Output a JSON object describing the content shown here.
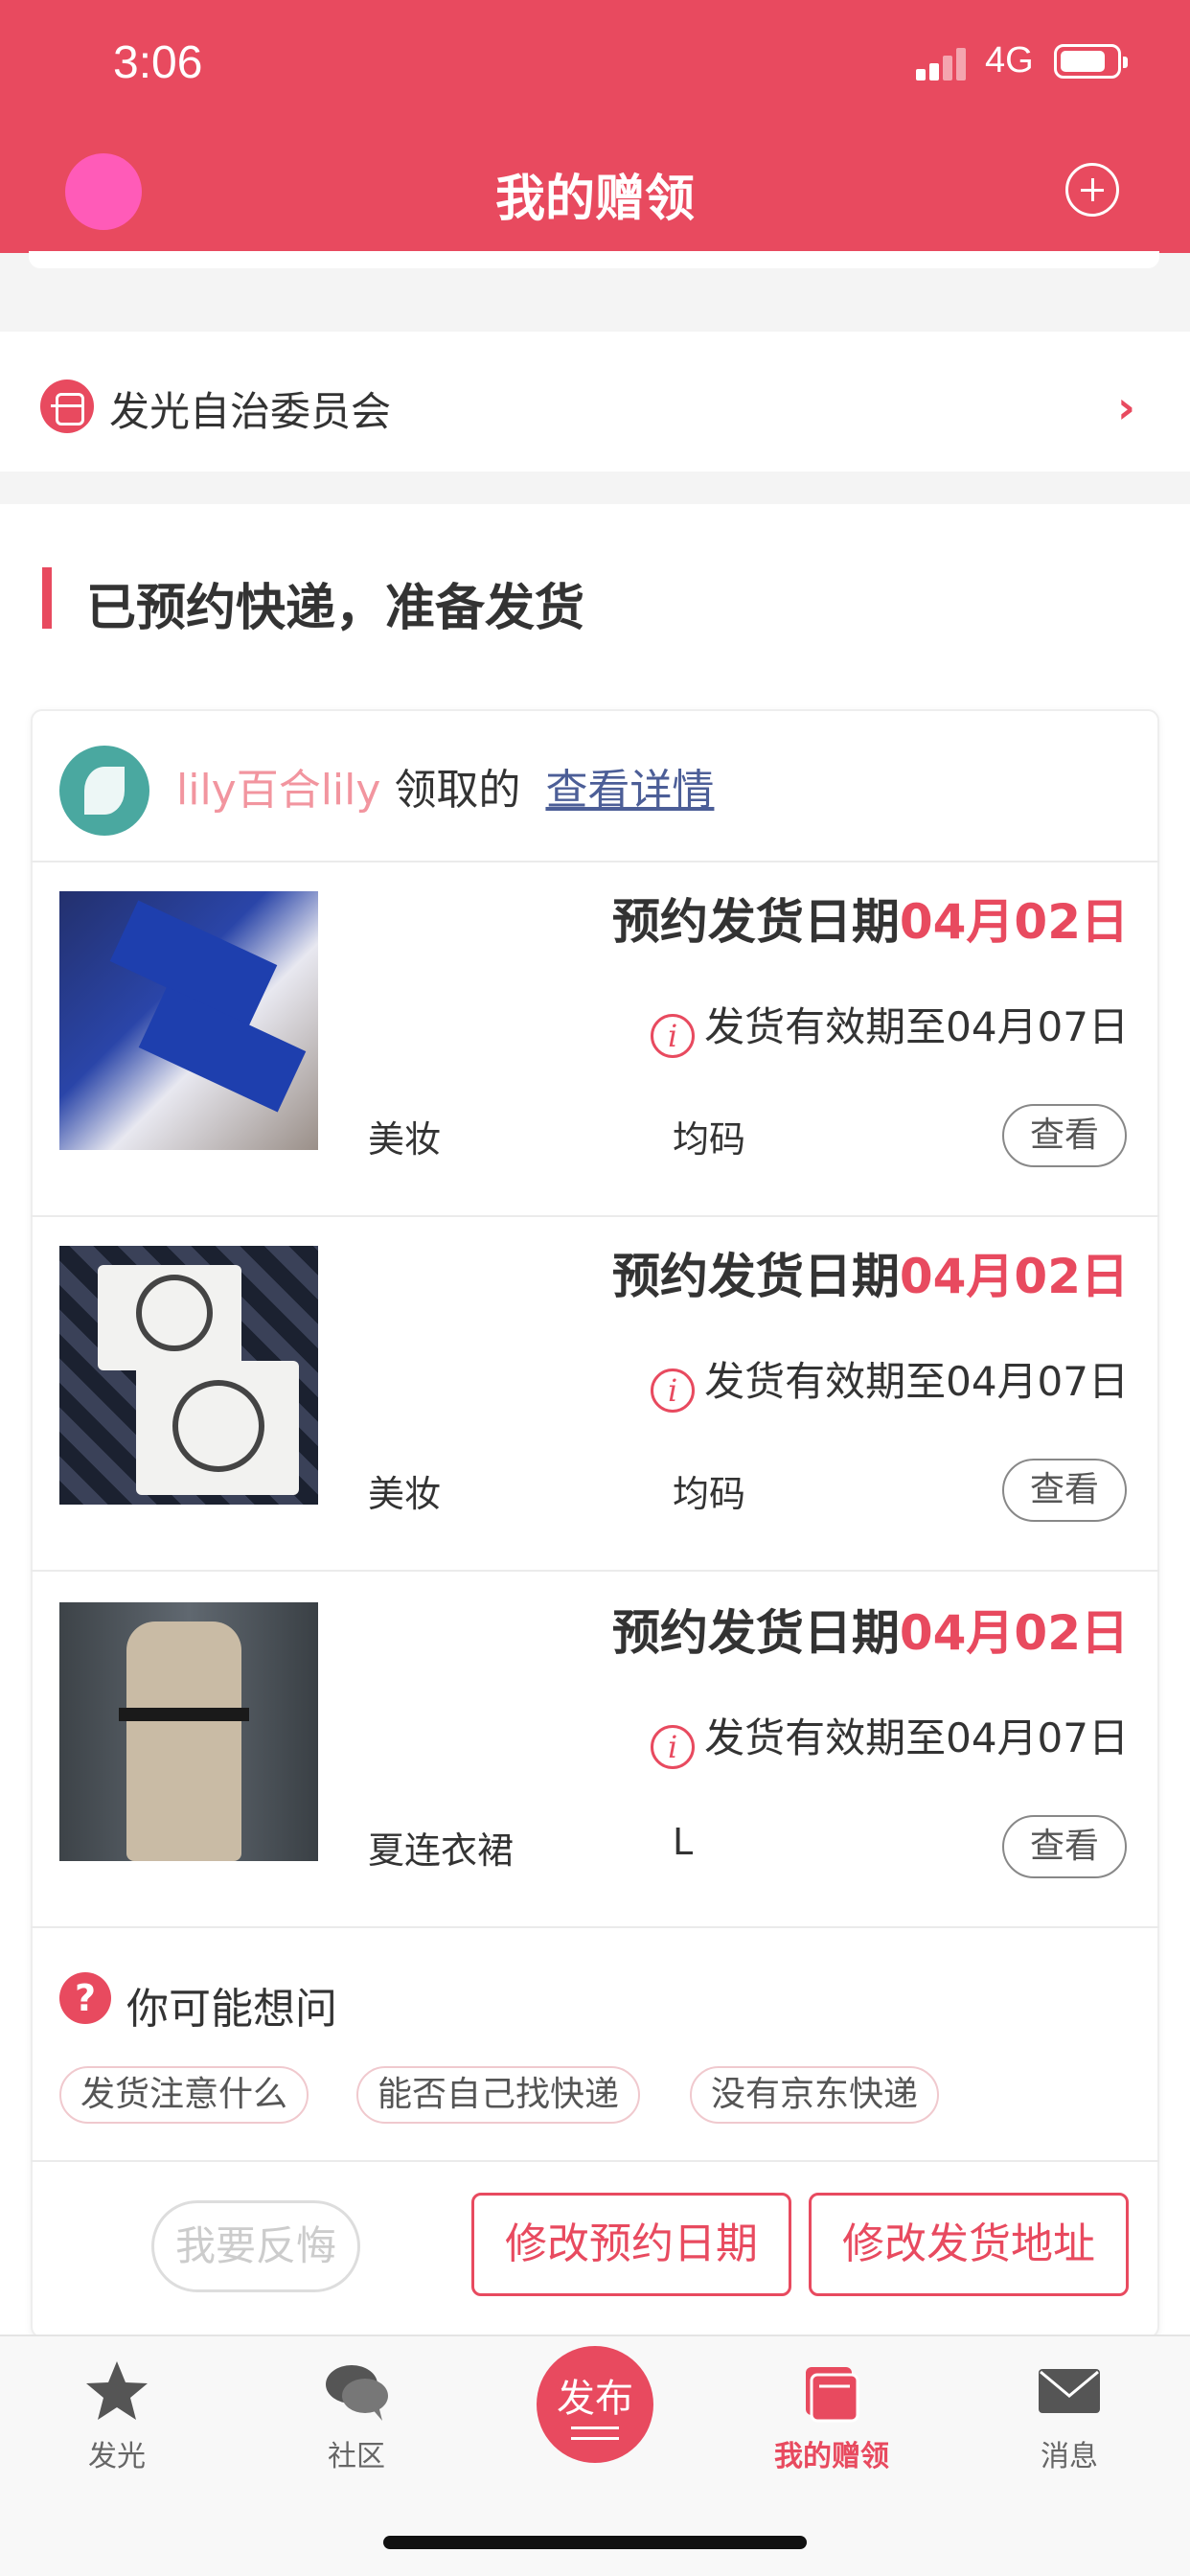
{
  "status_bar": {
    "time": "3:06",
    "network": "4G"
  },
  "header": {
    "title": "我的赠领"
  },
  "committee": {
    "label": "发光自治委员会"
  },
  "section": {
    "title": "已预约快递，准备发货"
  },
  "order": {
    "giver_name": "lily百合lily",
    "claim_text": "领取的",
    "detail_link": "查看详情"
  },
  "items": [
    {
      "ship_label": "预约发货日期",
      "ship_date": "04月02日",
      "valid_text": "发货有效期至04月07日",
      "category": "美妆",
      "size": "均码",
      "view_label": "查看"
    },
    {
      "ship_label": "预约发货日期",
      "ship_date": "04月02日",
      "valid_text": "发货有效期至04月07日",
      "category": "美妆",
      "size": "均码",
      "view_label": "查看"
    },
    {
      "ship_label": "预约发货日期",
      "ship_date": "04月02日",
      "valid_text": "发货有效期至04月07日",
      "category": "夏连衣裙",
      "size": "L",
      "view_label": "查看"
    }
  ],
  "faq": {
    "title": "你可能想问",
    "tags": [
      "发货注意什么",
      "能否自己找快递",
      "没有京东快递"
    ]
  },
  "actions": {
    "regret": "我要反悔",
    "change_date": "修改预约日期",
    "change_address": "修改发货地址"
  },
  "tabbar": {
    "items": [
      "发光",
      "社区",
      "发布",
      "我的赠领",
      "消息"
    ],
    "active": "我的赠领"
  },
  "colors": {
    "accent": "#e84a5f",
    "link": "#4c5e97",
    "giver_name": "#f2959f"
  }
}
